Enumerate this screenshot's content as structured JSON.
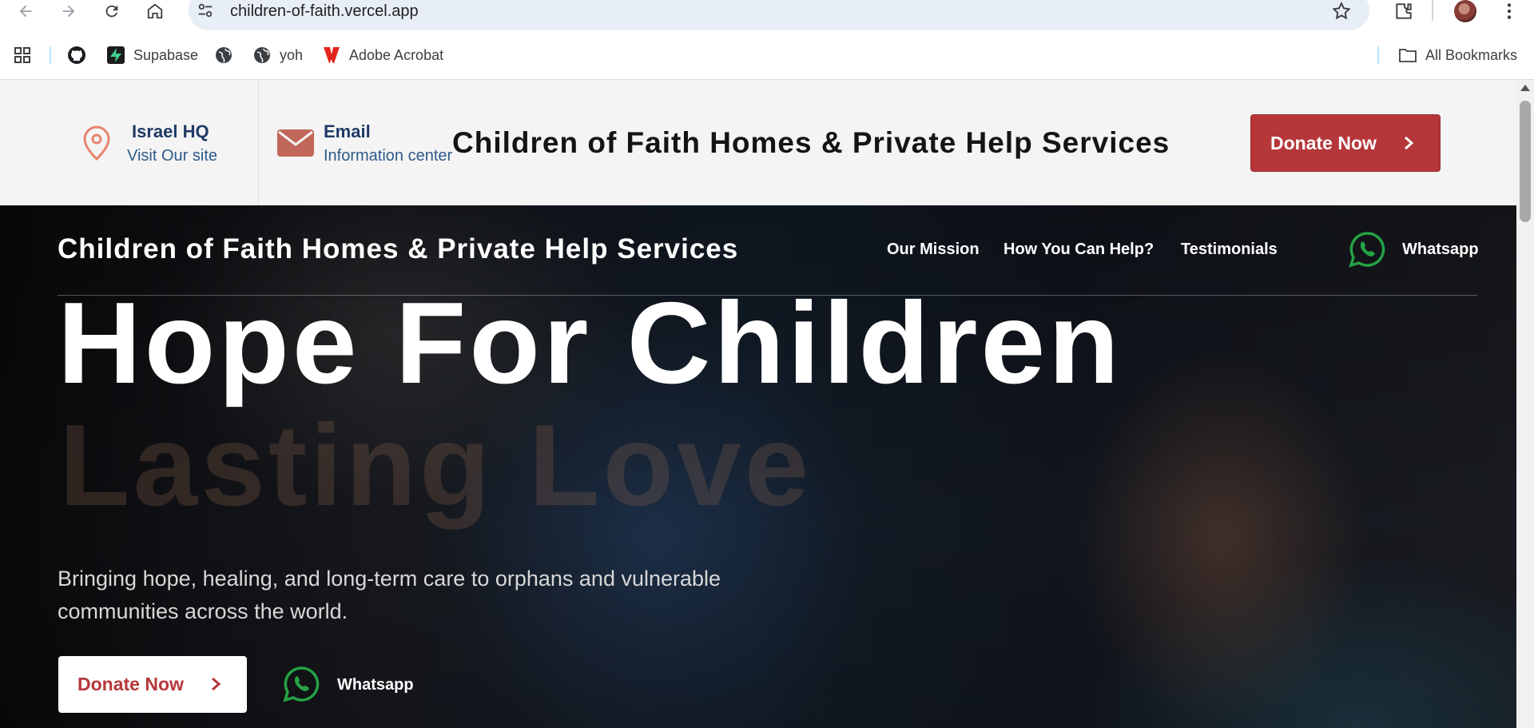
{
  "browser": {
    "url": "children-of-faith.vercel.app",
    "bookmarks": [
      {
        "label": "",
        "icon": "apps-grid-icon"
      },
      {
        "label": "",
        "icon": "github-icon"
      },
      {
        "label": "Supabase",
        "icon": "supabase-icon"
      },
      {
        "label": "",
        "icon": "globe-icon"
      },
      {
        "label": "yoh",
        "icon": "globe-icon"
      },
      {
        "label": "Adobe Acrobat",
        "icon": "adobe-acrobat-icon"
      }
    ],
    "all_bookmarks_label": "All Bookmarks"
  },
  "topbar": {
    "location_title": "Israel HQ",
    "location_sub": "Visit Our site",
    "email_title": "Email",
    "email_sub": "Information center",
    "brand": "Children of Faith Homes & Private Help Services",
    "donate_label": "Donate Now"
  },
  "hero": {
    "brand": "Children of Faith Homes & Private Help Services",
    "nav": [
      "Our Mission",
      "How You Can Help?",
      "Testimonials"
    ],
    "whatsapp_label": "Whatsapp",
    "headline": "Hope For Children",
    "headline_secondary": "Lasting Love",
    "description": "Bringing hope, healing, and long-term care to orphans and vulnerable communities across the world.",
    "donate_label": "Donate Now",
    "whatsapp_secondary_label": "Whatsapp"
  },
  "colors": {
    "brand_red": "#b5373a",
    "whatsapp_green": "#25a244",
    "navy": "#1f3a66"
  }
}
